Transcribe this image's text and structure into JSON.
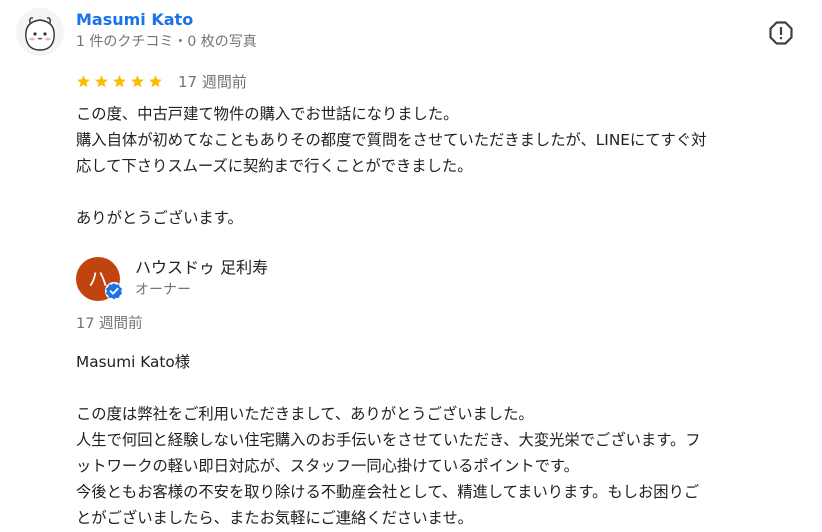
{
  "reviewer": {
    "name": "Masumi Kato",
    "meta": "1 件のクチコミ・0 枚の写真",
    "avatar_icon": "cartoon-character-avatar"
  },
  "review": {
    "rating": 5,
    "rating_max": 5,
    "star_color": "#fbbc04",
    "time": "17 週間前",
    "lines": [
      "この度、中古戸建て物件の購入でお世話になりました。",
      "購入自体が初めてなこともありその都度で質問をさせていただきましたが、LINEにてすぐ対",
      "応して下さりスムーズに契約まで行くことができました。",
      "",
      "ありがとうございます。"
    ]
  },
  "report_button": {
    "icon": "report-flag-icon"
  },
  "owner_reply": {
    "avatar_letter": "ハ",
    "avatar_color": "#c1440e",
    "verified_color": "#1a73e8",
    "name": "ハウスドゥ 足利寿",
    "role": "オーナー",
    "time": "17 週間前",
    "lines": [
      "Masumi Kato様",
      "",
      "この度は弊社をご利用いただきまして、ありがとうございました。",
      "人生で何回と経験しない住宅購入のお手伝いをさせていただき、大変光栄でございます。フ",
      "ットワークの軽い即日対応が、スタッフ一同心掛けているポイントです。",
      "今後ともお客様の不安を取り除ける不動産会社として、精進してまいります。もしお困りご",
      "とがございましたら、またお気軽にご連絡くださいませ。"
    ]
  }
}
